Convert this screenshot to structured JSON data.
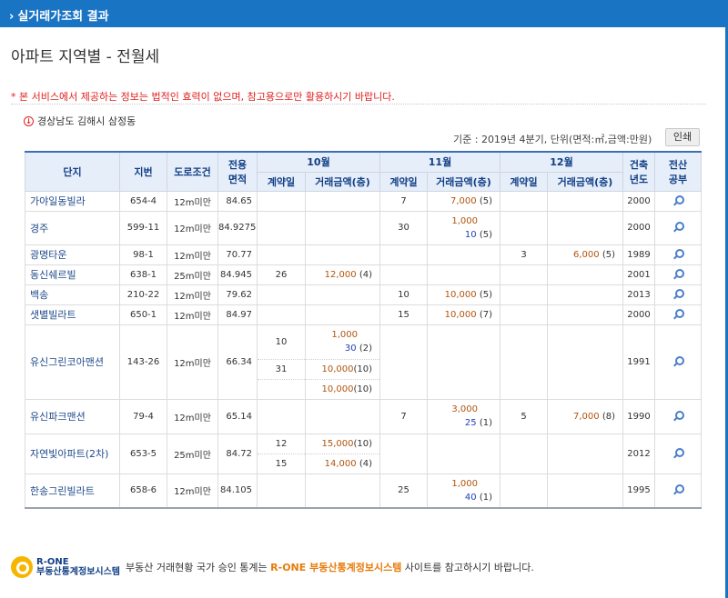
{
  "header": {
    "arrow": "›",
    "title": "실거래가조회 결과"
  },
  "page_title": "아파트 지역별 - 전월세",
  "notice": "* 본 서비스에서 제공하는 정보는 법적인 효력이 없으며, 참고용으로만 활용하시기 바랍니다.",
  "location": {
    "icon": "location-marker-icon",
    "text": "경상남도 김해시 삼정동"
  },
  "basis": "기준 : 2019년 4분기, 단위(면적:㎡,금액:만원)",
  "print_label": "인쇄",
  "columns": {
    "complex": "단지",
    "lot": "지번",
    "road": "도로조건",
    "area_l1": "전용",
    "area_l2": "면적",
    "m10": "10월",
    "m11": "11월",
    "m12": "12월",
    "contract_day": "계약일",
    "amount": "거래금액(층)",
    "year_l1": "건축",
    "year_l2": "년도",
    "doc_l1": "전산",
    "doc_l2": "공부"
  },
  "rows": [
    {
      "name": "가야일동빌라",
      "lot": "654-4",
      "road": "12m미만",
      "area": "84.65",
      "m11_day": "7",
      "m11_amt": "7,000",
      "m11_floor": "(5)",
      "year": "2000"
    },
    {
      "name": "경주",
      "lot": "599-11",
      "road": "12m미만",
      "area": "84.9275",
      "m11_day": "30",
      "m11_deposit": "1,000",
      "m11_rent": "10",
      "m11_floor": "(5)",
      "year": "2000"
    },
    {
      "name": "광명타운",
      "lot": "98-1",
      "road": "12m미만",
      "area": "70.77",
      "m12_day": "3",
      "m12_amt": "6,000",
      "m12_floor": "(5)",
      "year": "1989"
    },
    {
      "name": "동신쉐르빌",
      "lot": "638-1",
      "road": "25m미만",
      "area": "84.945",
      "m10_day": "26",
      "m10_amt": "12,000",
      "m10_floor": "(4)",
      "year": "2001"
    },
    {
      "name": "백송",
      "lot": "210-22",
      "road": "12m미만",
      "area": "79.62",
      "m11_day": "10",
      "m11_amt": "10,000",
      "m11_floor": "(5)",
      "year": "2013"
    },
    {
      "name": "샛별빌라트",
      "lot": "650-1",
      "road": "12m미만",
      "area": "84.97",
      "m11_day": "15",
      "m11_amt": "10,000",
      "m11_floor": "(7)",
      "year": "2000"
    },
    {
      "name": "유신그린코아맨션",
      "lot": "143-26",
      "road": "12m미만",
      "area": "66.34",
      "m10_a_day": "10",
      "m10_a_deposit": "1,000",
      "m10_a_rent": "30",
      "m10_a_floor": "(2)",
      "m10_b_day": "31",
      "m10_b_amt": "10,000",
      "m10_b_floor": "(10)",
      "m10_c_amt": "10,000",
      "m10_c_floor": "(10)",
      "year": "1991"
    },
    {
      "name": "유신파크맨션",
      "lot": "79-4",
      "road": "12m미만",
      "area": "65.14",
      "m11_day": "7",
      "m11_deposit": "3,000",
      "m11_rent": "25",
      "m11_floor": "(1)",
      "m12_day": "5",
      "m12_amt": "7,000",
      "m12_floor": "(8)",
      "year": "1990"
    },
    {
      "name": "자연빛아파트(2차)",
      "lot": "653-5",
      "road": "25m미만",
      "area": "84.72",
      "m10_a_day": "12",
      "m10_a_amt": "15,000",
      "m10_a_floor": "(10)",
      "m10_b_day": "15",
      "m10_b_amt": "14,000",
      "m10_b_floor": "(4)",
      "year": "2012"
    },
    {
      "name": "한송그린빌라트",
      "lot": "658-6",
      "road": "12m미만",
      "area": "84.105",
      "m11_day": "25",
      "m11_deposit": "1,000",
      "m11_rent": "40",
      "m11_floor": "(1)",
      "year": "1995"
    }
  ],
  "footer": {
    "logo_line1": "R-ONE",
    "logo_line2": "부동산통계정보시스템",
    "text_before": "부동산 거래현황 국가 승인 통계는 ",
    "highlight": "R-ONE 부동산통계정보시스템",
    "text_after": " 사이트를 참고하시기 바랍니다."
  },
  "colors": {
    "header_bg": "#1a74c4",
    "notice": "#e0201f",
    "amount_brown": "#b2530d",
    "amount_blue": "#2041b8",
    "footer_highlight": "#e87b0a"
  }
}
